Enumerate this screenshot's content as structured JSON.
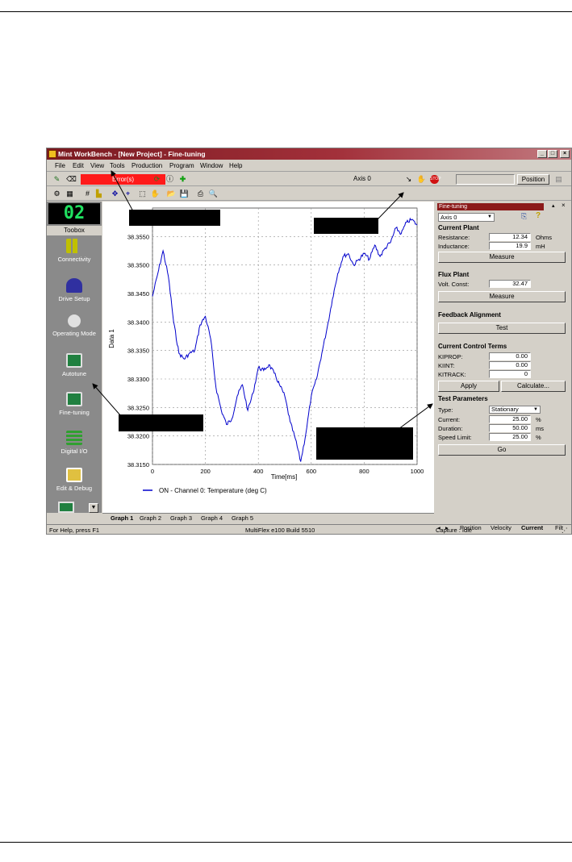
{
  "window": {
    "title": "Mint WorkBench - [New Project] - Fine-tuning",
    "controls": [
      "_",
      "□",
      "×"
    ]
  },
  "menu": [
    "File",
    "Edit",
    "View",
    "Tools",
    "Production",
    "Program",
    "Window",
    "Help"
  ],
  "toolbar1": {
    "error_label": "Error(s)",
    "axis_label": "Axis 0",
    "position_button": "Position"
  },
  "toolbox": {
    "display": "02",
    "title": "Toobox",
    "items": [
      "Connectivity",
      "Drive Setup",
      "Operating Mode",
      "Autotune",
      "Fine-tuning",
      "Digital I/O",
      "Edit & Debug"
    ]
  },
  "graph": {
    "ylabel": "Data 1",
    "xlabel": "Time[ms]",
    "legend": "ON  - Channel 0: Temperature (deg C)",
    "tabs": [
      "Graph 1",
      "Graph 2",
      "Graph 3",
      "Graph 4",
      "Graph 5"
    ]
  },
  "chart_data": {
    "type": "line",
    "title": "",
    "xlabel": "Time[ms]",
    "ylabel": "Data 1",
    "xlim": [
      0,
      1000
    ],
    "ylim": [
      38.315,
      38.36
    ],
    "x_ticks": [
      "0",
      "200",
      "400",
      "600",
      "800",
      "1000"
    ],
    "y_ticks": [
      "38.3150",
      "38.3200",
      "38.3250",
      "38.3300",
      "38.3350",
      "38.3400",
      "38.3450",
      "38.3500",
      "38.3550"
    ],
    "grid": true,
    "legend_position": "bottom",
    "series": [
      {
        "name": "ON  - Channel 0: Temperature (deg C)",
        "color": "#0000cc",
        "x": [
          0,
          20,
          40,
          60,
          80,
          100,
          120,
          140,
          160,
          180,
          200,
          220,
          240,
          260,
          280,
          300,
          320,
          340,
          360,
          380,
          400,
          420,
          440,
          460,
          480,
          500,
          520,
          540,
          560,
          580,
          600,
          620,
          640,
          660,
          680,
          700,
          720,
          740,
          760,
          780,
          800,
          820,
          840,
          860,
          880,
          900,
          920,
          940,
          960,
          980,
          1000
        ],
        "y": [
          38.3445,
          38.3485,
          38.3525,
          38.348,
          38.34,
          38.3345,
          38.3335,
          38.3345,
          38.335,
          38.3395,
          38.341,
          38.337,
          38.3285,
          38.3245,
          38.322,
          38.323,
          38.327,
          38.329,
          38.3245,
          38.3275,
          38.332,
          38.3315,
          38.3325,
          38.331,
          38.329,
          38.327,
          38.3225,
          38.3195,
          38.3155,
          38.3205,
          38.327,
          38.33,
          38.3345,
          38.339,
          38.344,
          38.3485,
          38.3515,
          38.352,
          38.35,
          38.351,
          38.352,
          38.351,
          38.3535,
          38.3515,
          38.353,
          38.354,
          38.3565,
          38.3555,
          38.3575,
          38.358,
          38.357
        ]
      }
    ]
  },
  "panel": {
    "title": "Fine-tuning",
    "axis_select": "Axis 0",
    "current_plant": {
      "heading": "Current Plant",
      "resistance_label": "Resistance:",
      "resistance": "12.34",
      "resistance_unit": "Ohms",
      "inductance_label": "Inductance:",
      "inductance": "19.9",
      "inductance_unit": "mH",
      "measure": "Measure"
    },
    "flux_plant": {
      "heading": "Flux Plant",
      "volt_label": "Volt. Const:",
      "volt": "32.47",
      "measure": "Measure"
    },
    "feedback": {
      "heading": "Feedback Alignment",
      "test": "Test"
    },
    "control_terms": {
      "heading": "Current Control Terms",
      "kiprop_label": "KIPROP:",
      "kiprop": "0.00",
      "kiint_label": "KIINT:",
      "kiint": "0.00",
      "kitrack_label": "KITRACK:",
      "kitrack": "0",
      "apply": "Apply",
      "calculate": "Calculate..."
    },
    "test_params": {
      "heading": "Test Parameters",
      "type_label": "Type:",
      "type": "Stationary",
      "current_label": "Current:",
      "current": "25.00",
      "current_unit": "%",
      "duration_label": "Duration:",
      "duration": "50.00",
      "duration_unit": "ms",
      "speed_label": "Speed Limit:",
      "speed": "25.00",
      "speed_unit": "%",
      "go": "Go"
    },
    "tabs": [
      "Position",
      "Velocity",
      "Current",
      "Filt"
    ]
  },
  "status": {
    "help": "For Help, press F1",
    "build": "MultiFlex e100 Build 5510",
    "capture": "Capture : Idle"
  }
}
